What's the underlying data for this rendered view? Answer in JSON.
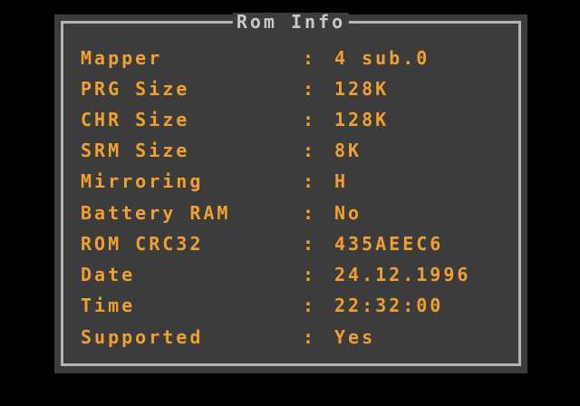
{
  "window": {
    "title": "Rom Info"
  },
  "colors": {
    "background": "#000000",
    "panel": "#3c3c3c",
    "border": "#b4b4b4",
    "text": "#f0a030",
    "title": "#c8c8c8"
  },
  "separator": ":",
  "rows": [
    {
      "label": "Mapper",
      "value": "4 sub.0"
    },
    {
      "label": "PRG Size",
      "value": "128K"
    },
    {
      "label": "CHR Size",
      "value": "128K"
    },
    {
      "label": "SRM Size",
      "value": "8K"
    },
    {
      "label": "Mirroring",
      "value": "H"
    },
    {
      "label": "Battery RAM",
      "value": "No"
    },
    {
      "label": "ROM CRC32",
      "value": "435AEEC6"
    },
    {
      "label": "Date",
      "value": "24.12.1996"
    },
    {
      "label": "Time",
      "value": "22:32:00"
    },
    {
      "label": "Supported",
      "value": "Yes"
    }
  ]
}
